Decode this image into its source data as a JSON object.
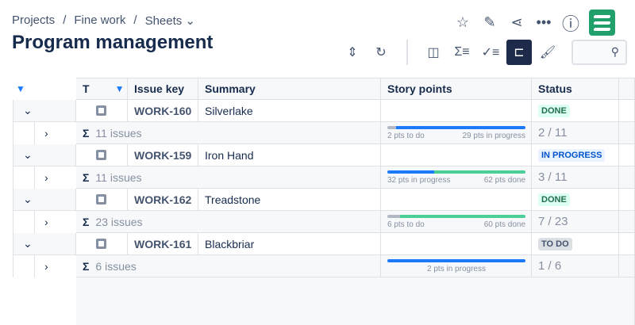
{
  "breadcrumbs": [
    "Projects",
    "/",
    "Fine work",
    "/",
    "Sheets ⌄"
  ],
  "title": "Program management",
  "columns": {
    "type": "T",
    "issue_key": "Issue key",
    "summary": "Summary",
    "story_points": "Story points",
    "status": "Status"
  },
  "colors": {
    "blue": "#1d7afc",
    "green": "#4bce97",
    "gray": "#b3b9c4"
  },
  "groups": [
    {
      "key": "WORK-160",
      "summary": "Silverlake",
      "status": "DONE",
      "status_bg": "#dcfff1",
      "status_fg": "#216e4e",
      "issues": "11 issues",
      "progress": "2 / 11",
      "todo": 2,
      "inprog": 29,
      "done": 0,
      "labels": [
        "2 pts to do",
        "29 pts in progress"
      ]
    },
    {
      "key": "WORK-159",
      "summary": "Iron Hand",
      "status": "IN PROGRESS",
      "status_bg": "#e9f2ff",
      "status_fg": "#0055cc",
      "issues": "11 issues",
      "progress": "3 / 11",
      "todo": 0,
      "inprog": 32,
      "done": 62,
      "labels": [
        "32 pts in progress",
        "62 pts done"
      ]
    },
    {
      "key": "WORK-162",
      "summary": "Treadstone",
      "status": "DONE",
      "status_bg": "#dcfff1",
      "status_fg": "#216e4e",
      "issues": "23 issues",
      "progress": "7 / 23",
      "todo": 6,
      "inprog": 0,
      "done": 60,
      "labels": [
        "6 pts to do",
        "60 pts done"
      ]
    },
    {
      "key": "WORK-161",
      "summary": "Blackbriar",
      "status": "TO DO",
      "status_bg": "#dcdfe4",
      "status_fg": "#44546f",
      "issues": "6 issues",
      "progress": "1 / 6",
      "todo": 0,
      "inprog": 2,
      "done": 0,
      "labels": [
        "2 pts in progress"
      ]
    }
  ]
}
